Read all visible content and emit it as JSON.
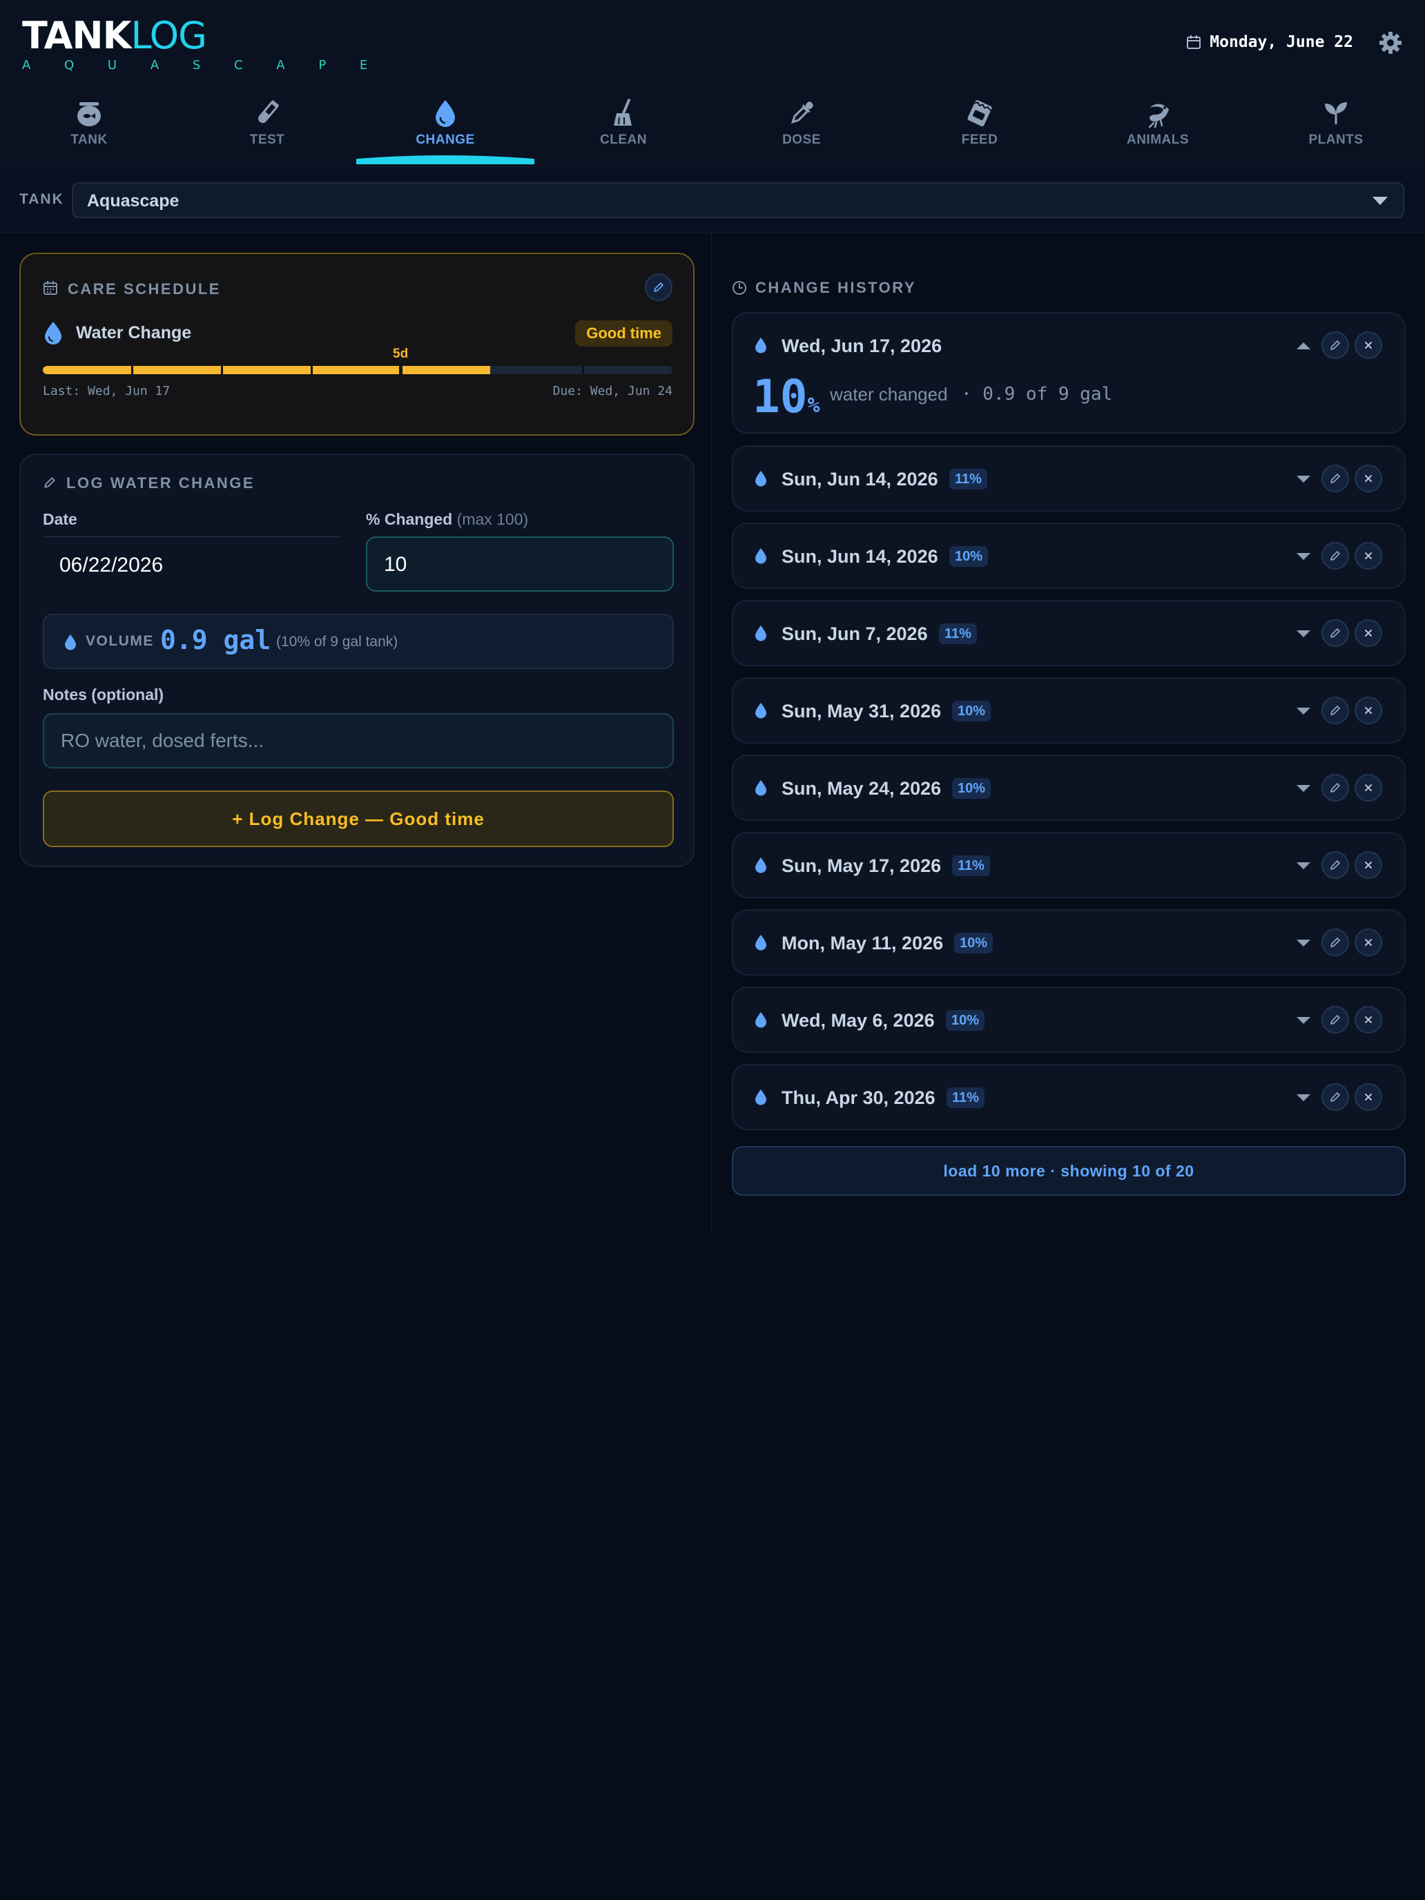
{
  "app": {
    "logo_a": "TANK",
    "logo_b": "LOG",
    "subtitle": "A Q U A S C A P E",
    "date": "Monday, June 22"
  },
  "nav": [
    {
      "label": "TANK",
      "icon": "fishbowl-icon",
      "active": false
    },
    {
      "label": "TEST",
      "icon": "test-tube-icon",
      "active": false
    },
    {
      "label": "CHANGE",
      "icon": "water-drop-icon",
      "active": true
    },
    {
      "label": "CLEAN",
      "icon": "broom-icon",
      "active": false
    },
    {
      "label": "DOSE",
      "icon": "dropper-icon",
      "active": false
    },
    {
      "label": "FEED",
      "icon": "food-packet-icon",
      "active": false
    },
    {
      "label": "ANIMALS",
      "icon": "shrimp-icon",
      "active": false
    },
    {
      "label": "PLANTS",
      "icon": "leaf-icon",
      "active": false
    }
  ],
  "tank": {
    "label": "TANK",
    "value": "Aquascape"
  },
  "care": {
    "title": "CARE SCHEDULE",
    "task": "Water Change",
    "badge": "Good time",
    "days": "5d",
    "progress": 0.71,
    "last": "Last: Wed, Jun 17",
    "due": "Due: Wed, Jun 24"
  },
  "log": {
    "title": "LOG WATER CHANGE",
    "date_label": "Date",
    "date_value": "06/22/2026",
    "pct_label": "% Changed",
    "pct_hint": "(max 100)",
    "pct_value": "10",
    "volume_label": "VOLUME",
    "volume_value": "0.9 gal",
    "volume_sub": "(10% of 9 gal tank)",
    "notes_label": "Notes (optional)",
    "notes_placeholder": "RO water, dosed ferts...",
    "button": "+ Log Change — Good time"
  },
  "history": {
    "title": "CHANGE HISTORY",
    "expanded": {
      "date": "Wed, Jun 17, 2026",
      "pct": "10",
      "pct_sign": "%",
      "changed_text": "water changed",
      "detail": "· 0.9 of 9 gal"
    },
    "entries": [
      {
        "date": "Sun, Jun 14, 2026",
        "pct": "11%"
      },
      {
        "date": "Sun, Jun 14, 2026",
        "pct": "10%"
      },
      {
        "date": "Sun, Jun 7, 2026",
        "pct": "11%"
      },
      {
        "date": "Sun, May 31, 2026",
        "pct": "10%"
      },
      {
        "date": "Sun, May 24, 2026",
        "pct": "10%"
      },
      {
        "date": "Sun, May 17, 2026",
        "pct": "11%"
      },
      {
        "date": "Mon, May 11, 2026",
        "pct": "10%"
      },
      {
        "date": "Wed, May 6, 2026",
        "pct": "10%"
      },
      {
        "date": "Thu, Apr 30, 2026",
        "pct": "11%"
      }
    ],
    "load_more": "load 10 more · showing 10 of 20"
  },
  "colors": {
    "background": "#060c18",
    "accent_blue": "#60a5fa",
    "accent_cyan": "#22d3ee",
    "accent_amber": "#fbbf24",
    "logo_green": "#2dd4bf"
  }
}
